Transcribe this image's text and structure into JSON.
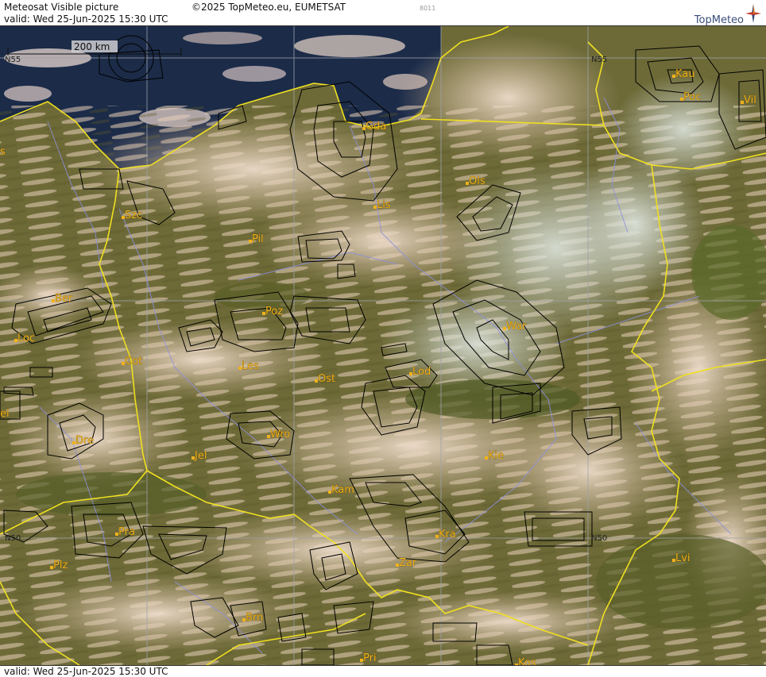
{
  "header": {
    "title": "Meteosat Visible picture",
    "copyright": "©2025 TopMeteo.eu, EUMETSAT",
    "code": "8011",
    "valid": "valid:  Wed  25-Jun-2025  15:30 UTC",
    "logo": "TopMeteo"
  },
  "footer": {
    "valid": "valid:  Wed  25-Jun-2025  15:30 UTC"
  },
  "scale": {
    "label": "200 km"
  },
  "grid_labels": {
    "n55_left": "N55",
    "n55_right": "N55",
    "n50_left": "N50",
    "n50_right": "N50"
  },
  "cities": [
    {
      "id": "gda",
      "name": "Gda"
    },
    {
      "id": "kau",
      "name": "Kau"
    },
    {
      "id": "poc",
      "name": "Poc"
    },
    {
      "id": "vil",
      "name": "Vil"
    },
    {
      "id": "ols",
      "name": "Ols"
    },
    {
      "id": "lis",
      "name": "Lis"
    },
    {
      "id": "szc",
      "name": "Szc"
    },
    {
      "id": "pil",
      "name": "Pil"
    },
    {
      "id": "ber",
      "name": "Ber"
    },
    {
      "id": "poz",
      "name": "Poz"
    },
    {
      "id": "loc",
      "name": "Loc"
    },
    {
      "id": "war",
      "name": "War"
    },
    {
      "id": "cot",
      "name": "Cot"
    },
    {
      "id": "les",
      "name": "Les"
    },
    {
      "id": "ost",
      "name": "Ost"
    },
    {
      "id": "lod",
      "name": "Lod"
    },
    {
      "id": "dre",
      "name": "Dre"
    },
    {
      "id": "wro",
      "name": "Wro"
    },
    {
      "id": "jel",
      "name": "Jel"
    },
    {
      "id": "kie",
      "name": "Kie"
    },
    {
      "id": "kam",
      "name": "Kam"
    },
    {
      "id": "pra",
      "name": "Pra"
    },
    {
      "id": "kra",
      "name": "Kra"
    },
    {
      "id": "lvi",
      "name": "Lvi"
    },
    {
      "id": "plz",
      "name": "Plz"
    },
    {
      "id": "zar",
      "name": "Zar"
    },
    {
      "id": "brn",
      "name": "Brn"
    },
    {
      "id": "pri",
      "name": "Pri"
    },
    {
      "id": "kos",
      "name": "Kos"
    },
    {
      "id": "s_edge",
      "name": "s"
    },
    {
      "id": "ei_edge",
      "name": "ei"
    }
  ],
  "colors": {
    "sea": "#1a2a47",
    "land": "#6e6a36",
    "cloud": "#d9c2a8",
    "border": "#f0e020",
    "river": "#8a8fe0",
    "contour": "#000000",
    "city_label": "#f2b21a"
  }
}
